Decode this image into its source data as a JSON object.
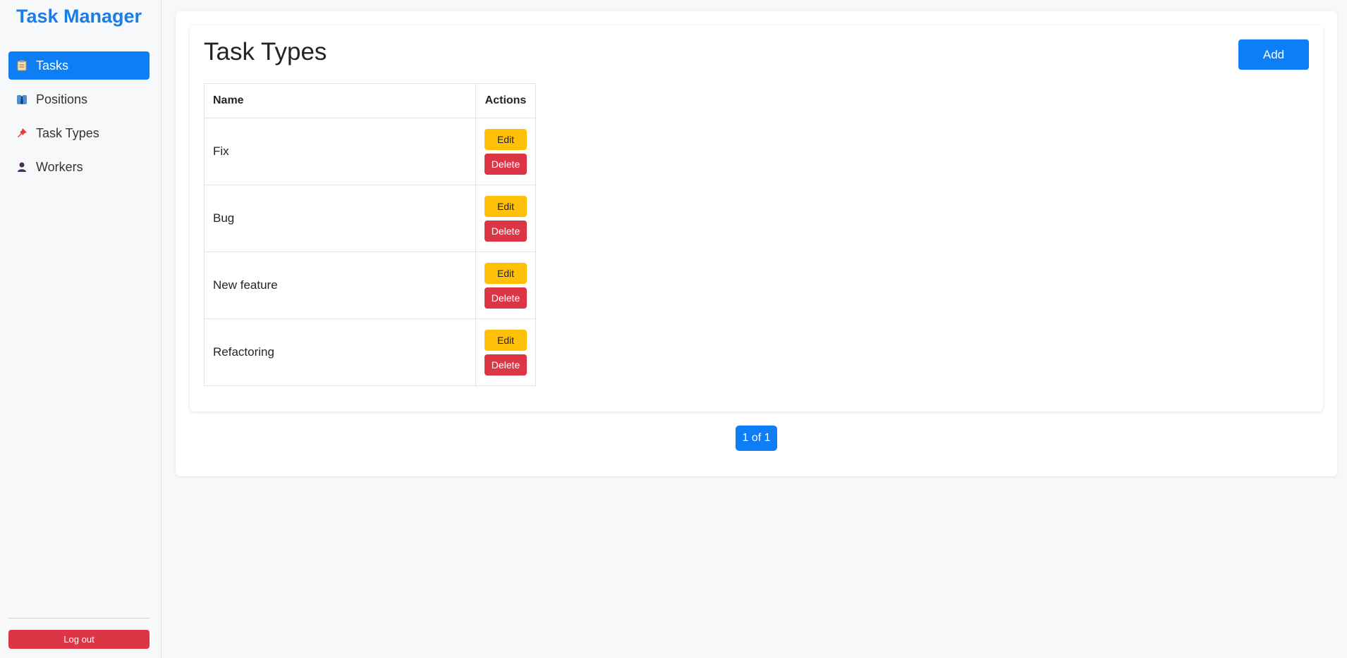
{
  "app": {
    "title": "Task Manager"
  },
  "sidebar": {
    "items": [
      {
        "label": "Tasks",
        "icon": "clipboard-icon",
        "active": true
      },
      {
        "label": "Positions",
        "icon": "tie-icon",
        "active": false
      },
      {
        "label": "Task Types",
        "icon": "pushpin-icon",
        "active": false
      },
      {
        "label": "Workers",
        "icon": "person-icon",
        "active": false
      }
    ],
    "logout_label": "Log out"
  },
  "page": {
    "title": "Task Types",
    "add_label": "Add"
  },
  "table": {
    "headers": {
      "name": "Name",
      "actions": "Actions"
    },
    "edit_label": "Edit",
    "delete_label": "Delete",
    "rows": [
      {
        "name": "Fix"
      },
      {
        "name": "Bug"
      },
      {
        "name": "New feature"
      },
      {
        "name": "Refactoring"
      }
    ]
  },
  "pagination": {
    "label": "1 of 1"
  },
  "colors": {
    "primary": "#0d7ef5",
    "brand": "#1a7ce8",
    "warning": "#ffc107",
    "danger": "#dc3545"
  }
}
